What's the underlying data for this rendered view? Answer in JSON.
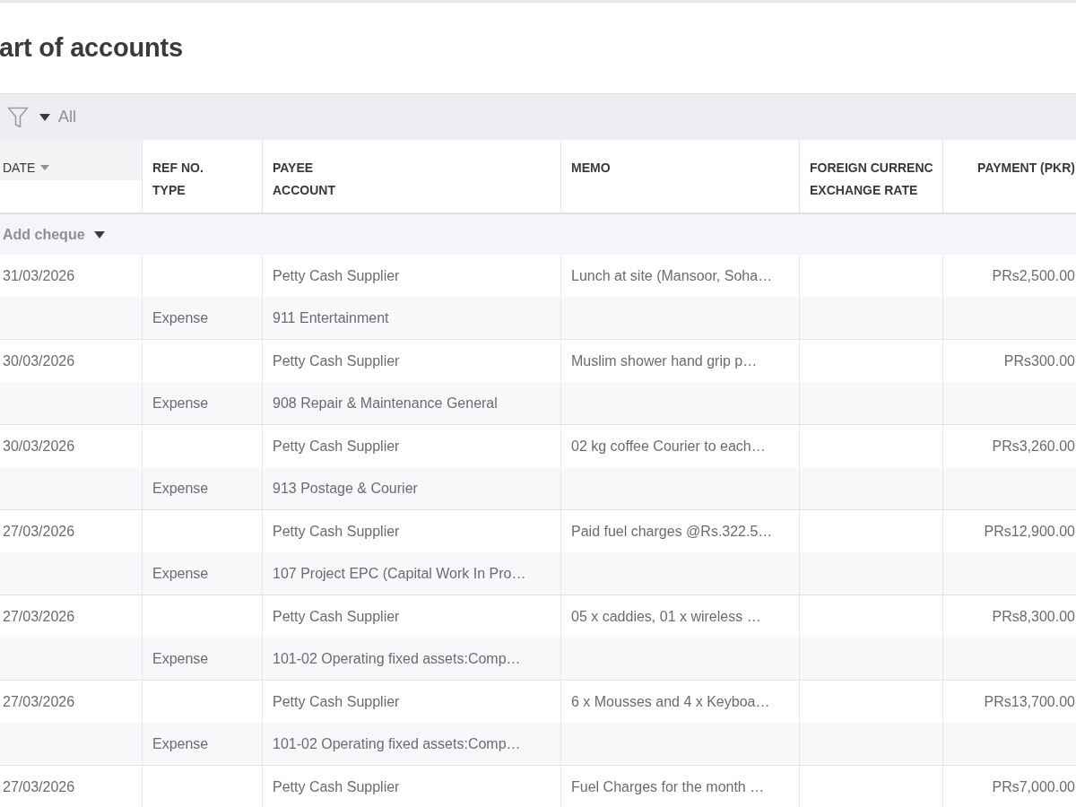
{
  "page": {
    "title": "art of accounts"
  },
  "filter_bar": {
    "value": "All"
  },
  "table": {
    "columns": [
      {
        "label": "DATE",
        "sorted": true
      },
      {
        "label": "REF NO.",
        "sub_label": "TYPE",
        "sorted": false
      },
      {
        "label": "PAYEE",
        "sub_label": "ACCOUNT",
        "sorted": false
      },
      {
        "label": "MEMO",
        "sorted": false
      },
      {
        "label": "FOREIGN CURRENC",
        "sub_label": "EXCHANGE RATE",
        "sorted": false
      },
      {
        "label": "PAYMENT (PKR)",
        "sorted": false
      }
    ],
    "add_row": {
      "label": "Add cheque"
    },
    "rows": [
      {
        "date": "31/03/2026",
        "payee": "Petty Cash Supplier",
        "memo": "Lunch at site (Mansoor, Soha…",
        "payment": "PRs2,500.00",
        "type": "Expense",
        "account": "911 Entertainment"
      },
      {
        "date": "30/03/2026",
        "payee": "Petty Cash Supplier",
        "memo": "Muslim shower hand grip p…",
        "payment": "PRs300.00",
        "type": "Expense",
        "account": "908 Repair & Maintenance General"
      },
      {
        "date": "30/03/2026",
        "payee": "Petty Cash Supplier",
        "memo": "02 kg coffee Courier to each…",
        "payment": "PRs3,260.00",
        "type": "Expense",
        "account": "913 Postage & Courier"
      },
      {
        "date": "27/03/2026",
        "payee": "Petty Cash Supplier",
        "memo": "Paid fuel charges @Rs.322.5…",
        "payment": "PRs12,900.00",
        "type": "Expense",
        "account": "107 Project EPC (Capital Work In Pro…"
      },
      {
        "date": "27/03/2026",
        "payee": "Petty Cash Supplier",
        "memo": "05 x caddies, 01 x wireless …",
        "payment": "PRs8,300.00",
        "type": "Expense",
        "account": "101-02 Operating fixed assets:Comp…"
      },
      {
        "date": "27/03/2026",
        "payee": "Petty Cash Supplier",
        "memo": "6 x Mousses and 4 x Keyboa…",
        "payment": "PRs13,700.00",
        "type": "Expense",
        "account": "101-02 Operating fixed assets:Comp…"
      },
      {
        "date": "27/03/2026",
        "payee": "Petty Cash Supplier",
        "memo": "Fuel Charges for the month …",
        "payment": "PRs7,000.00"
      }
    ]
  }
}
